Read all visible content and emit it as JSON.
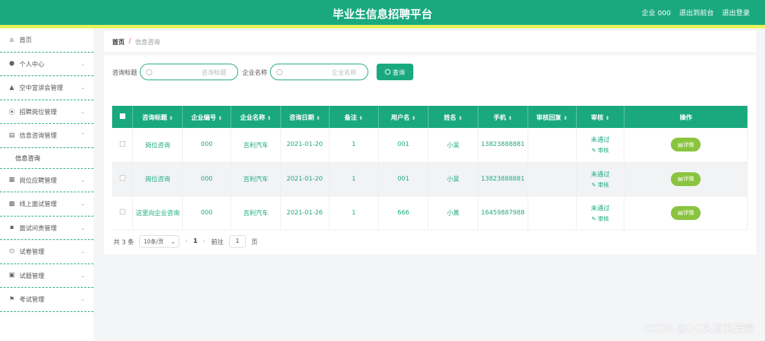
{
  "header": {
    "title": "毕业生信息招聘平台",
    "account": "企业 000",
    "to_front": "退出到前台",
    "logout": "退出登录"
  },
  "sidebar": {
    "items": [
      {
        "label": "首页",
        "icon": "home-icon"
      },
      {
        "label": "个人中心",
        "icon": "user-icon"
      },
      {
        "label": "空中宣讲会管理",
        "icon": "stamp-icon"
      },
      {
        "label": "招聘岗位管理",
        "icon": "aperture-icon"
      },
      {
        "label": "信息咨询管理",
        "icon": "server-icon"
      },
      {
        "label": "岗位应聘管理",
        "icon": "table-icon"
      },
      {
        "label": "线上面试管理",
        "icon": "bar-chart-icon"
      },
      {
        "label": "面试问责管理",
        "icon": "chart-icon"
      },
      {
        "label": "试卷管理",
        "icon": "power-icon"
      },
      {
        "label": "试题管理",
        "icon": "clipboard-icon"
      },
      {
        "label": "考试管理",
        "icon": "flag-icon"
      }
    ],
    "active_sub": "信息咨询"
  },
  "breadcrumb": {
    "home": "首页",
    "separator": "/",
    "current": "信息咨询"
  },
  "search": {
    "title_label": "咨询标题",
    "title_placeholder": "咨询标题",
    "company_label": "企业名称",
    "company_placeholder": "企业名称",
    "query_button": "查询"
  },
  "table": {
    "columns": [
      "咨询标题",
      "企业编号",
      "企业名称",
      "咨询日期",
      "备注",
      "用户名",
      "姓名",
      "手机",
      "审核回复",
      "审核",
      "操作"
    ],
    "rows": [
      {
        "title": "岗位咨询",
        "company_no": "000",
        "company_name": "吉利汽车",
        "date": "2021-01-20",
        "remark": "1",
        "username": "001",
        "name": "小吴",
        "phone": "13823888881",
        "reply": "",
        "status": "未通过",
        "audit": "审核",
        "detail": "详情"
      },
      {
        "title": "岗位咨询",
        "company_no": "000",
        "company_name": "吉利汽车",
        "date": "2021-01-20",
        "remark": "1",
        "username": "001",
        "name": "小吴",
        "phone": "13823888881",
        "reply": "",
        "status": "未通过",
        "audit": "审核",
        "detail": "详情"
      },
      {
        "title": "这里向企业咨询",
        "company_no": "000",
        "company_name": "吉利汽车",
        "date": "2021-01-26",
        "remark": "1",
        "username": "666",
        "name": "小黑",
        "phone": "16459887988",
        "reply": "",
        "status": "未通过",
        "audit": "审核",
        "detail": "详情"
      }
    ]
  },
  "pagination": {
    "total": "共 3 条",
    "page_size": "10条/页",
    "current_page": "1",
    "goto_label": "前往",
    "goto_value": "1",
    "page_unit": "页"
  },
  "watermark": "CSDN @DC头发很茂密",
  "colors": {
    "primary": "#1aa97f",
    "accent_bar": "#e9f25a",
    "detail_button": "#8ac43f"
  }
}
